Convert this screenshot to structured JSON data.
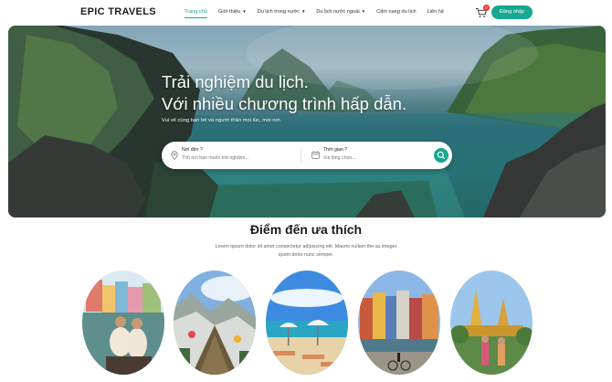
{
  "header": {
    "logo": "EPIC TRAVELS",
    "nav": [
      {
        "label": "Trang chủ",
        "active": true,
        "dropdown": false
      },
      {
        "label": "Giới thiệu",
        "active": false,
        "dropdown": true
      },
      {
        "label": "Du lịch trong nước",
        "active": false,
        "dropdown": true
      },
      {
        "label": "Du lịch nước ngoài",
        "active": false,
        "dropdown": true
      },
      {
        "label": "Cẩm nang du lịch",
        "active": false,
        "dropdown": false
      },
      {
        "label": "Liên hệ",
        "active": false,
        "dropdown": false
      }
    ],
    "cart_count": "0",
    "login_label": "Đăng nhập"
  },
  "hero": {
    "title_line1": "Trải nghiệm du lịch.",
    "title_line2": "Với nhiều chương trình hấp dẫn.",
    "subtitle": "Vui vẻ cùng bạn bè và người thân mọi lúc, mọi nơi.",
    "search": {
      "where_label": "Nơi đến ?",
      "where_placeholder": "Tìm nơi bạn muốn trải nghiệm...",
      "when_label": "Thời gian ?",
      "when_placeholder": "Vui lòng chọn..."
    }
  },
  "favorites": {
    "title": "Điểm đến ưa thích",
    "description": "Lorem ipsum dolor sit amet consectetur adipiscing elit. Mauris nullam the as integer quam dolor nunc semper."
  },
  "colors": {
    "accent": "#17a88f",
    "badge": "#e53935"
  },
  "icons": [
    "cart-icon",
    "location-pin-icon",
    "calendar-icon",
    "search-icon",
    "chevron-down-icon"
  ]
}
